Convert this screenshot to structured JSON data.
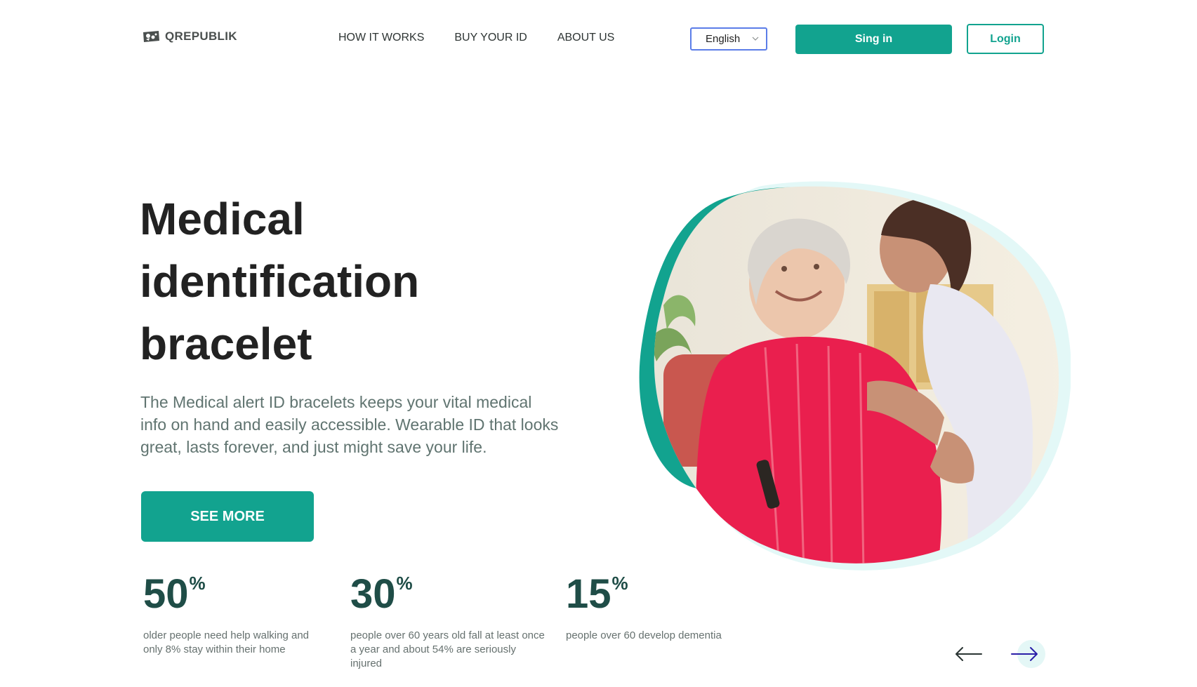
{
  "brand": {
    "name": "QREPUBLIK",
    "accent_color": "#12a38f",
    "dark_text_color": "#1f4d47"
  },
  "nav": {
    "items": [
      {
        "label": "HOW IT WORKS"
      },
      {
        "label": "BUY YOUR ID"
      },
      {
        "label": "ABOUT US"
      }
    ]
  },
  "language": {
    "selected": "English"
  },
  "auth": {
    "signin_label": "Sing in",
    "login_label": "Login"
  },
  "hero": {
    "title_lines": [
      "Medical",
      "identification",
      "bracelet"
    ],
    "description": "The Medical alert ID bracelets keeps your vital medical info on hand and easily accessible. Wearable ID that looks great, lasts forever, and just might save your life.",
    "cta_label": "SEE MORE",
    "image_icon": "elderly-woman-with-nurse-photo"
  },
  "stats": [
    {
      "value": "50",
      "suffix": "%",
      "text": "older people need help walking and only 8% stay within their home"
    },
    {
      "value": "30",
      "suffix": "%",
      "text": "people over 60 years old fall at least once a year and about 54% are seriously injured"
    },
    {
      "value": "15",
      "suffix": "%",
      "text": "people over 60 develop dementia"
    }
  ],
  "carousel": {
    "prev_icon": "arrow-left-icon",
    "next_icon": "arrow-right-icon"
  }
}
